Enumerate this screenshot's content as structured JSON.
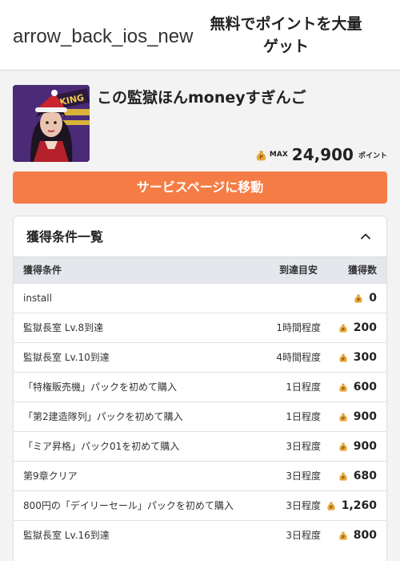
{
  "header": {
    "back_label": "arrow_back_ios_new",
    "title": "無料でポイントを大量ゲット"
  },
  "game": {
    "title": "この監獄ほんmoneyすぎんご",
    "max_label": "MAX",
    "max_points": "24,900",
    "points_unit": "ポイント",
    "thumbnail_icon": "game-character-thumbnail",
    "coin_icon": "coin-bag-icon"
  },
  "service_button": "サービスページに移動",
  "conditions": {
    "title": "獲得条件一覧",
    "expanded": true,
    "columns": {
      "condition": "獲得条件",
      "time": "到達目安",
      "points": "獲得数"
    },
    "rows": [
      {
        "condition": "install",
        "time": "",
        "points": "0"
      },
      {
        "condition": "監獄長室 Lv.8到達",
        "time": "1時間程度",
        "points": "200"
      },
      {
        "condition": "監獄長室 Lv.10到達",
        "time": "4時間程度",
        "points": "300"
      },
      {
        "condition": "「特権販売機」パックを初めて購入",
        "time": "1日程度",
        "points": "600"
      },
      {
        "condition": "「第2建造隊列」パックを初めて購入",
        "time": "1日程度",
        "points": "900"
      },
      {
        "condition": "「ミア昇格」パック01を初めて購入",
        "time": "3日程度",
        "points": "900"
      },
      {
        "condition": "第9章クリア",
        "time": "3日程度",
        "points": "680"
      },
      {
        "condition": "800円の「デイリーセール」パックを初めて購入",
        "time": "3日程度",
        "points": "1,260"
      },
      {
        "condition": "監獄長室 Lv.16到達",
        "time": "3日程度",
        "points": "800"
      }
    ]
  },
  "colors": {
    "accent": "#f57c45",
    "coin": "#e8a83a",
    "table_header_bg": "#e4e7ec"
  }
}
